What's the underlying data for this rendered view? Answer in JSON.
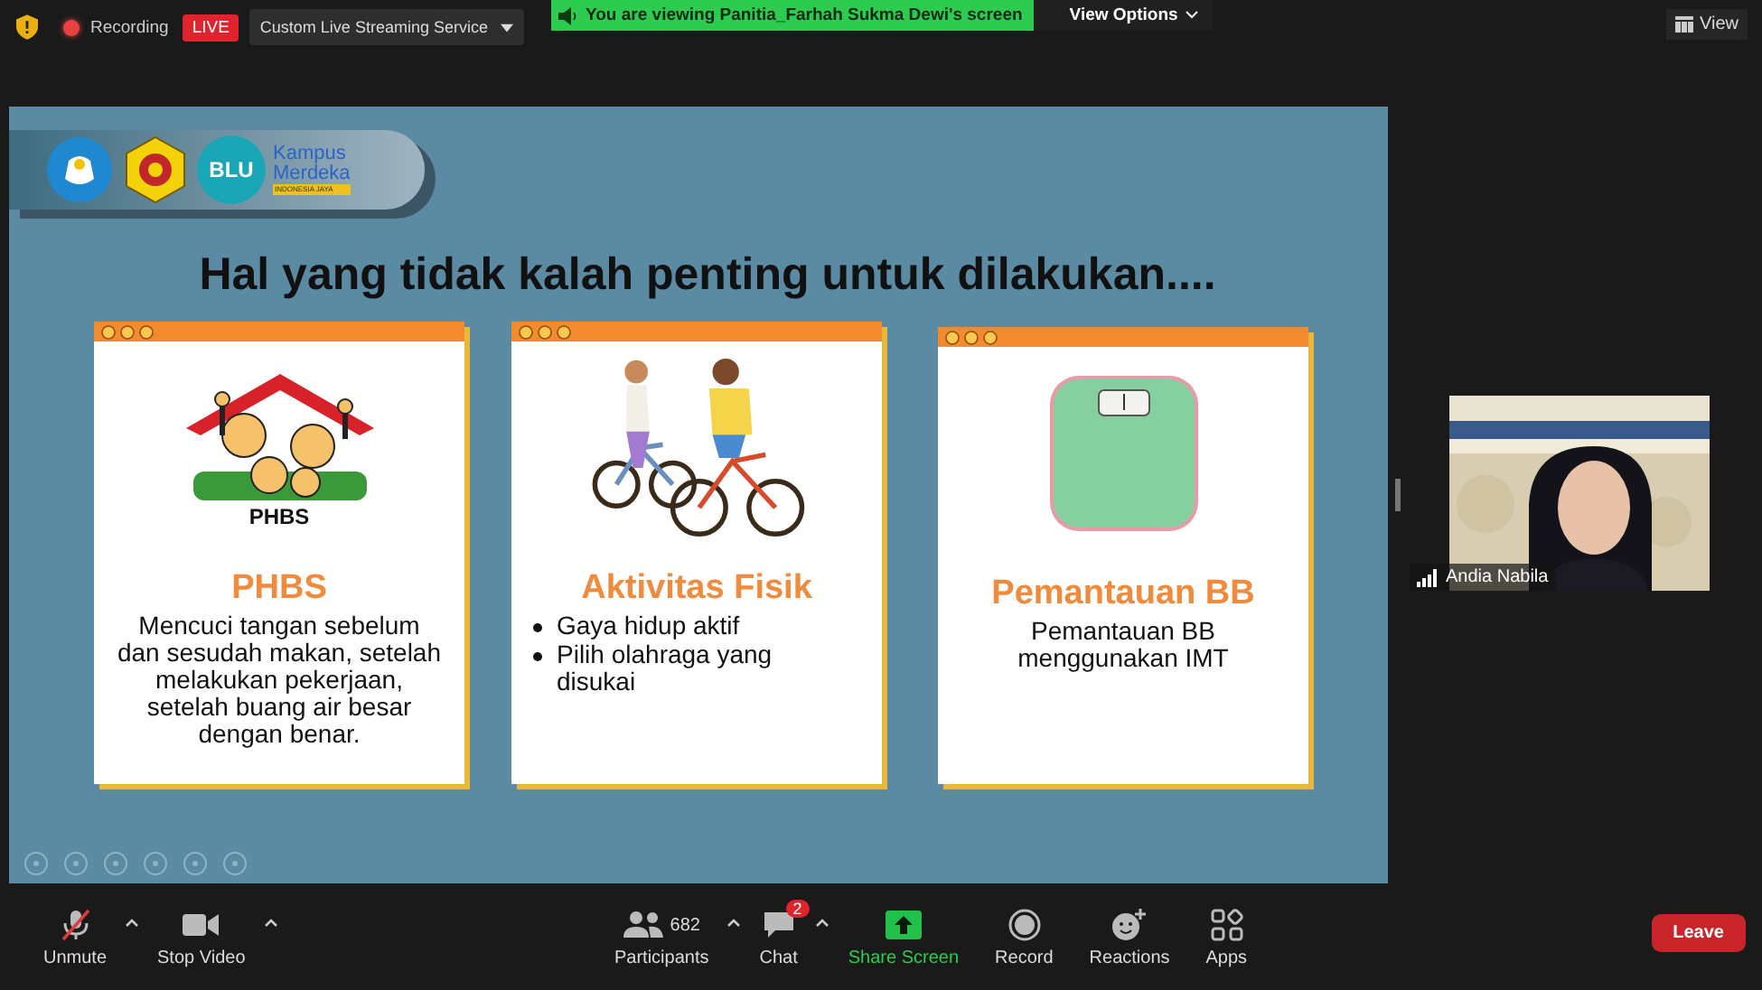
{
  "top_bar": {
    "recording_label": "Recording",
    "live_badge": "LIVE",
    "stream_menu": "Custom Live Streaming Service",
    "viewing_banner": "You are viewing Panitia_Farhah Sukma Dewi's screen",
    "view_options": "View Options",
    "view_button": "View"
  },
  "slide": {
    "logos": {
      "blu": "BLU",
      "kampus": "Kampus",
      "merdeka": "Merdeka",
      "tagline": "INDONESIA JAYA"
    },
    "title": "Hal yang tidak kalah penting untuk dilakukan....",
    "cards": [
      {
        "illustration_label": "PHBS",
        "heading": "PHBS",
        "kind": "paragraph",
        "body": "Mencuci tangan sebelum dan sesudah makan, setelah melakukan pekerjaan, setelah buang air besar dengan benar."
      },
      {
        "heading": "Aktivitas Fisik",
        "kind": "bullets",
        "bullets": [
          "Gaya hidup aktif",
          "Pilih olahraga yang disukai"
        ]
      },
      {
        "heading": "Pemantauan BB",
        "kind": "paragraph",
        "body": "Pemantauan BB menggunakan IMT"
      }
    ]
  },
  "video": {
    "kind": "picture",
    "name": "Andia Nabila"
  },
  "toolbar": [
    {
      "label": "Unmute"
    },
    {
      "label": "Stop Video"
    },
    {
      "label": "Participants",
      "count": "682"
    },
    {
      "label": "Chat",
      "badge": "2"
    },
    {
      "label": "Share Screen"
    },
    {
      "label": "Record"
    },
    {
      "label": "Reactions"
    },
    {
      "label": "Apps"
    }
  ],
  "leave_button": "Leave"
}
